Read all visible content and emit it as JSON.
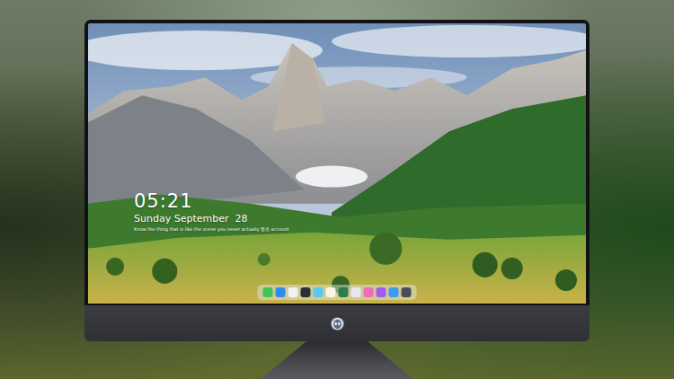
{
  "lock_screen": {
    "time": "05:21",
    "date": "Sunday September  28",
    "message": "Know the thing that is like the scene you never actually 签名 account"
  },
  "dock": {
    "apps": [
      {
        "color": "#3fc25a"
      },
      {
        "color": "#2f8cf0"
      },
      {
        "color": "#f2f2f2"
      },
      {
        "color": "#2b2f36"
      },
      {
        "color": "#59c9f0"
      },
      {
        "color": "#fbf6e3"
      },
      {
        "color": "#2e7d4f"
      },
      {
        "color": "#e8e8ee"
      },
      {
        "color": "#f06bb8"
      },
      {
        "color": "#a25cf0"
      },
      {
        "color": "#3b9cf5"
      },
      {
        "color": "#4a4d55"
      }
    ]
  }
}
